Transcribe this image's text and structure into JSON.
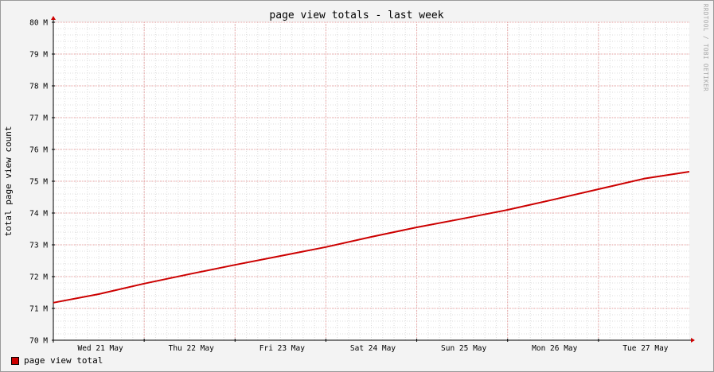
{
  "chart_data": {
    "type": "line",
    "title": "page view totals - last week",
    "xlabel": "",
    "ylabel": "total page view count",
    "watermark": "RRDTOOL / TOBI OETIKER",
    "x_tick_labels": [
      "Wed 21 May",
      "Thu 22 May",
      "Fri 23 May",
      "Sat 24 May",
      "Sun 25 May",
      "Mon 26 May",
      "Tue 27 May"
    ],
    "xlim": [
      0,
      7
    ],
    "x_major_ticks": [
      0.5,
      1.5,
      2.5,
      3.5,
      4.5,
      5.5,
      6.5
    ],
    "x_minor_step": 0.125,
    "y_tick_labels": [
      "70 M",
      "71 M",
      "72 M",
      "73 M",
      "74 M",
      "75 M",
      "76 M",
      "77 M",
      "78 M",
      "79 M",
      "80 M"
    ],
    "y_tick_values": [
      70,
      71,
      72,
      73,
      74,
      75,
      76,
      77,
      78,
      79,
      80
    ],
    "ylim": [
      70,
      80
    ],
    "y_minor_step": 0.2,
    "y_unit_note": "values in millions",
    "grid": true,
    "legend_position": "bottom-left",
    "series": [
      {
        "name": "page view total",
        "color": "#cc0000",
        "x": [
          0,
          0.5,
          1,
          1.5,
          2,
          2.5,
          3,
          3.5,
          4,
          4.5,
          5,
          5.5,
          6,
          6.5,
          7
        ],
        "values": [
          71.18,
          71.45,
          71.78,
          72.08,
          72.37,
          72.65,
          72.93,
          73.25,
          73.55,
          73.82,
          74.1,
          74.42,
          74.75,
          75.08,
          75.3
        ]
      }
    ]
  },
  "legend": {
    "label": "page view total",
    "color": "#cc0000"
  }
}
